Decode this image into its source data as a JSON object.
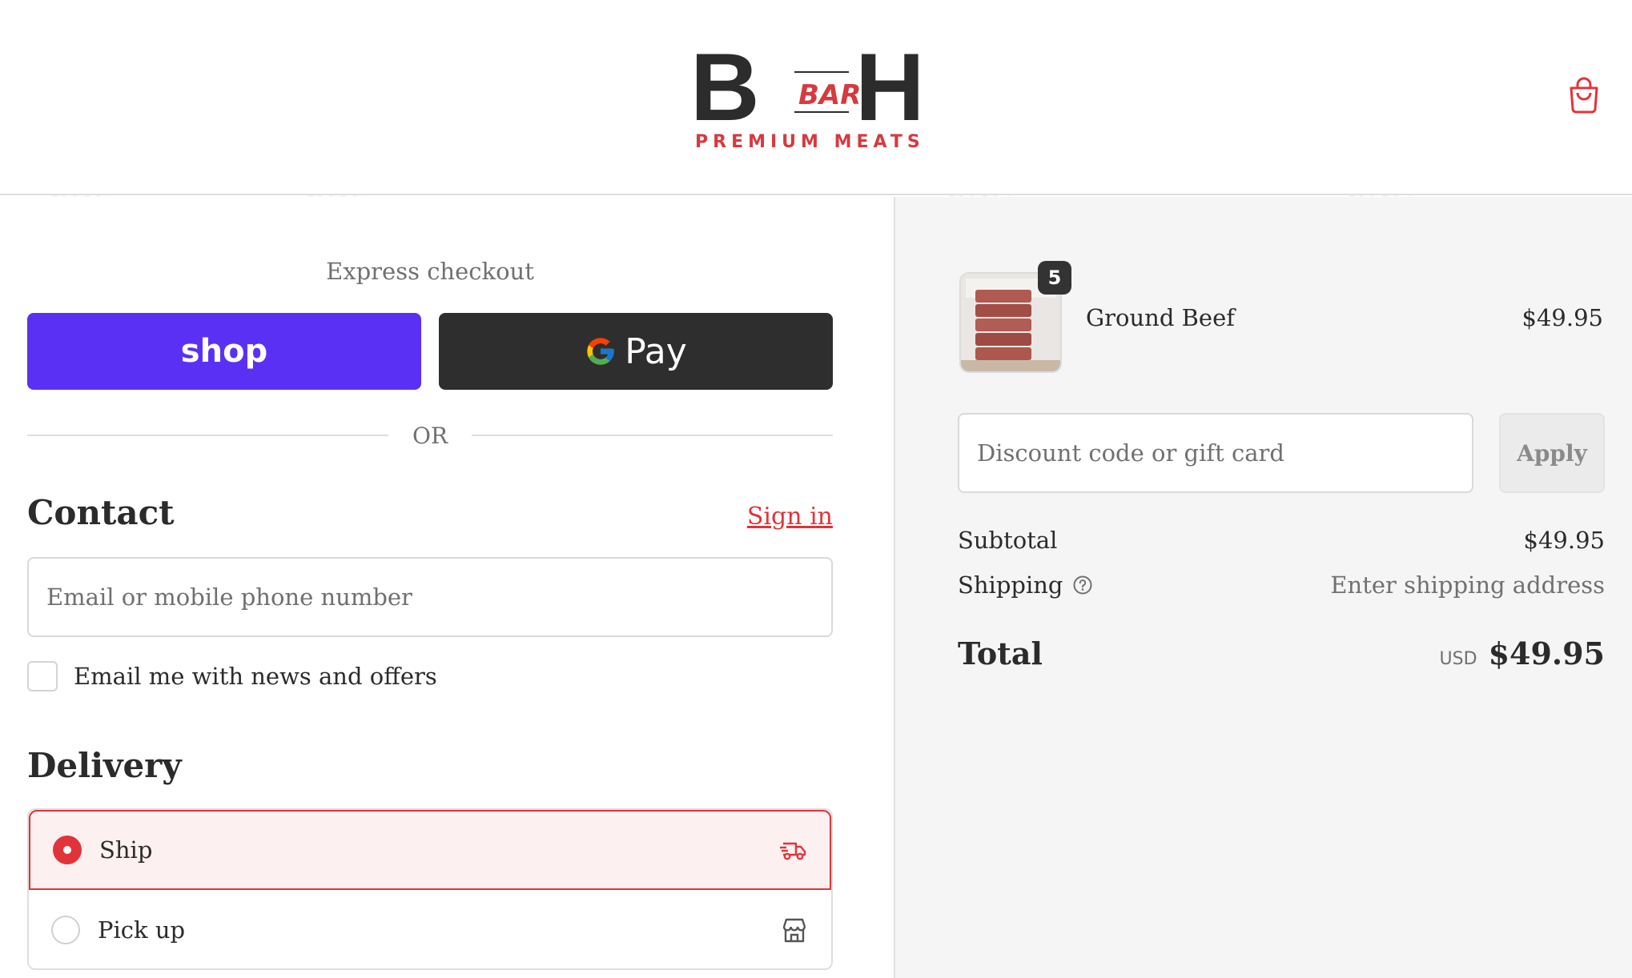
{
  "header": {
    "logo": {
      "letter_left": "B",
      "brand_mark": "BAR",
      "letter_right": "H",
      "tagline": "PREMIUM MEATS"
    },
    "cart_icon": "shopping-bag-icon"
  },
  "checkout": {
    "express_label": "Express checkout",
    "shop_pay_label": "shop",
    "google_pay_label": "Pay",
    "or_label": "OR"
  },
  "contact": {
    "heading": "Contact",
    "sign_in": "Sign in",
    "email_placeholder": "Email or mobile phone number",
    "newsletter_label": "Email me with news and offers"
  },
  "delivery": {
    "heading": "Delivery",
    "options": [
      {
        "label": "Ship",
        "selected": true,
        "icon": "delivery-truck-icon"
      },
      {
        "label": "Pick up",
        "selected": false,
        "icon": "store-icon"
      }
    ]
  },
  "summary": {
    "item": {
      "name": "Ground Beef",
      "quantity": "5",
      "price": "$49.95"
    },
    "discount_placeholder": "Discount code or gift card",
    "apply_label": "Apply",
    "subtotal_label": "Subtotal",
    "subtotal_value": "$49.95",
    "shipping_label": "Shipping",
    "shipping_value": "Enter shipping address",
    "total_label": "Total",
    "currency": "USD",
    "total_value": "$49.95"
  },
  "colors": {
    "accent": "#e0343a",
    "shop_pay": "#5a31f4",
    "google_pay": "#2e2e2e"
  }
}
